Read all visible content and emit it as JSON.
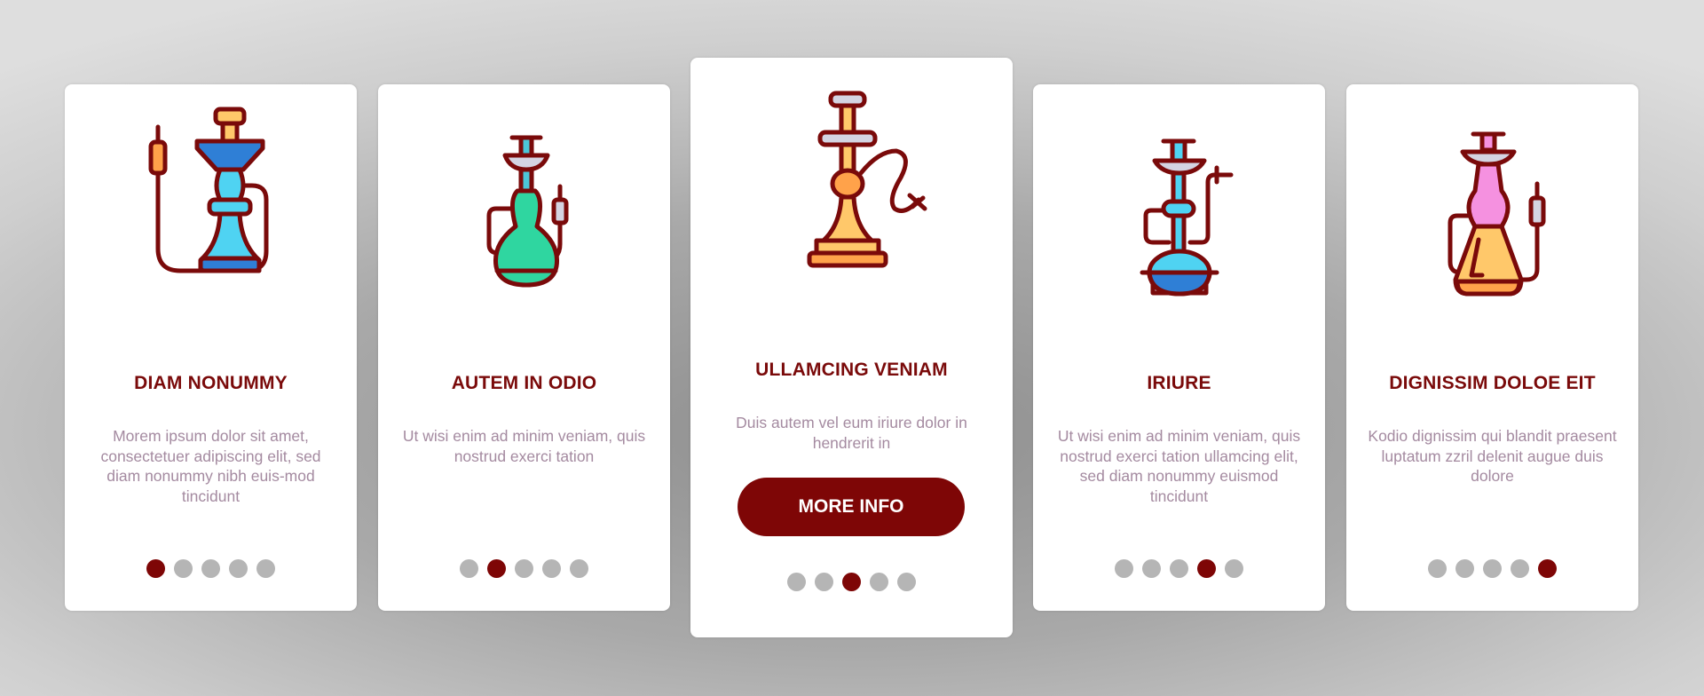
{
  "colors": {
    "title": "#7a0a0a",
    "description": "#a48aa0",
    "button_bg": "#7e0606",
    "button_text": "#ffffff",
    "dot_active": "#7e0606",
    "dot_inactive": "#b5b5b5",
    "outline": "#7a0a0a"
  },
  "cards": [
    {
      "icon": "hookah-blue-icon",
      "title": "DIAM NONUMMY",
      "description": "Morem ipsum dolor sit amet, consectetuer adipiscing elit, sed diam nonummy nibh euis-mod tincidunt",
      "active_dot": 1,
      "dots": [
        "page-1",
        "page-2",
        "page-3",
        "page-4",
        "page-5"
      ]
    },
    {
      "icon": "hookah-green-icon",
      "title": "AUTEM IN ODIO",
      "description": "Ut wisi enim ad minim veniam, quis nostrud exerci tation",
      "active_dot": 2,
      "dots": [
        "page-1",
        "page-2",
        "page-3",
        "page-4",
        "page-5"
      ]
    },
    {
      "icon": "hookah-orange-icon",
      "title": "ULLAMCING VENIAM",
      "description": "Duis autem vel eum iriure dolor in hendrerit in",
      "button_label": "MORE INFO",
      "active_dot": 3,
      "dots": [
        "page-1",
        "page-2",
        "page-3",
        "page-4",
        "page-5"
      ]
    },
    {
      "icon": "hookah-round-blue-icon",
      "title": "IRIURE",
      "description": "Ut wisi enim ad minim veniam, quis nostrud exerci tation ullamcing elit, sed diam nonummy euismod tincidunt",
      "active_dot": 4,
      "dots": [
        "page-1",
        "page-2",
        "page-3",
        "page-4",
        "page-5"
      ]
    },
    {
      "icon": "hookah-pink-icon",
      "title": "DIGNISSIM DOLOE EIT",
      "description": "Kodio dignissim qui blandit praesent luptatum zzril delenit augue duis dolore",
      "active_dot": 5,
      "dots": [
        "page-1",
        "page-2",
        "page-3",
        "page-4",
        "page-5"
      ]
    }
  ]
}
